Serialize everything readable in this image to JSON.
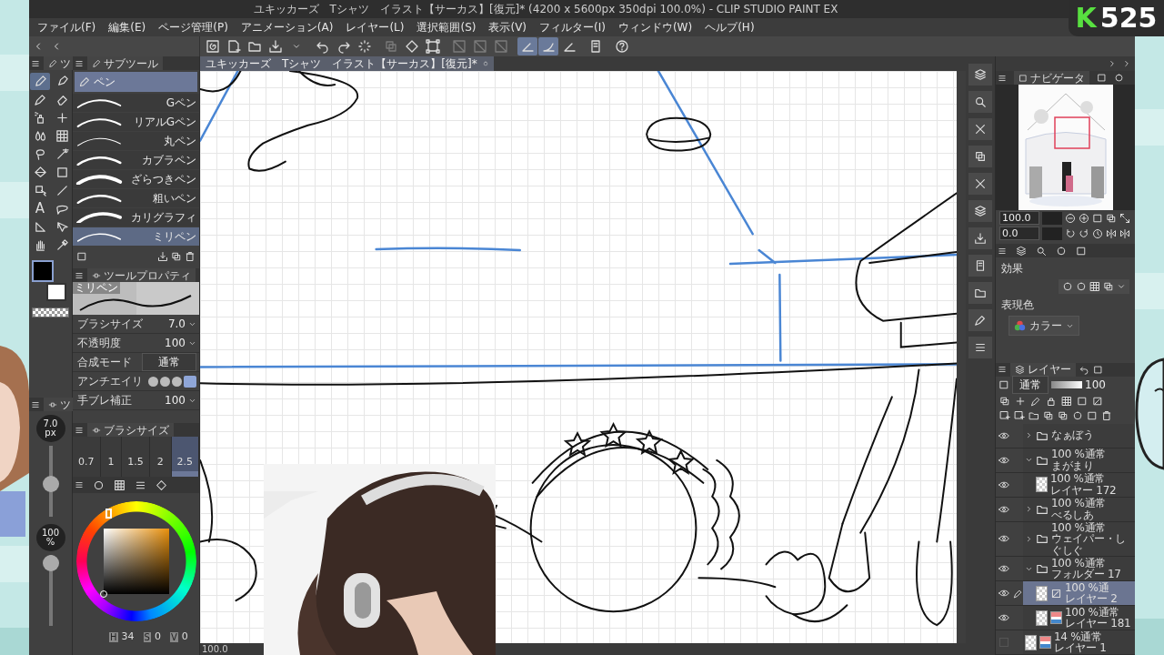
{
  "window": {
    "title": "ユキッカーズ　Tシャツ　イラスト【サーカス】[復元]* (4200 x 5600px 350dpi 100.0%)  - CLIP STUDIO PAINT EX"
  },
  "overlay_logo": {
    "letter": "K",
    "number": "525"
  },
  "menu": [
    "ファイル(F)",
    "編集(E)",
    "ページ管理(P)",
    "アニメーション(A)",
    "レイヤー(L)",
    "選択範囲(S)",
    "表示(V)",
    "フィルター(I)",
    "ウィンドウ(W)",
    "ヘルプ(H)"
  ],
  "toolbar": [
    {
      "on": false,
      "disabled": false
    },
    {
      "on": false,
      "disabled": false
    },
    {
      "on": false,
      "disabled": false
    },
    {
      "on": false,
      "disabled": false
    },
    {
      "on": false,
      "disabled": false
    },
    {
      "on": false,
      "disabled": false
    },
    {
      "on": false,
      "disabled": false
    },
    {
      "on": false,
      "disabled": false
    },
    {
      "on": false,
      "disabled": true
    },
    {
      "on": false,
      "disabled": false
    },
    {
      "on": false,
      "disabled": false
    },
    {
      "on": false,
      "disabled": true
    },
    {
      "on": false,
      "disabled": true
    },
    {
      "on": false,
      "disabled": true
    },
    {
      "on": true,
      "disabled": false
    },
    {
      "on": true,
      "disabled": false
    },
    {
      "on": false,
      "disabled": false
    },
    {
      "on": false,
      "disabled": false
    },
    {
      "on": false,
      "disabled": false
    }
  ],
  "document_tab": {
    "title": "ユキッカーズ　Tシャツ　イラスト【サーカス】[復元]*"
  },
  "tool_palette": {
    "tab": "ツ",
    "tools": [
      {
        "selected": true
      },
      {
        "selected": false
      },
      {
        "selected": false
      },
      {
        "selected": false
      },
      {
        "selected": false
      },
      {
        "selected": false
      },
      {
        "selected": false
      },
      {
        "selected": false
      },
      {
        "selected": false
      },
      {
        "selected": false
      },
      {
        "selected": false
      },
      {
        "selected": false
      },
      {
        "selected": false
      },
      {
        "selected": false
      },
      {
        "selected": false,
        "glyph": "A"
      },
      {
        "selected": false
      },
      {
        "selected": false
      },
      {
        "selected": false
      },
      {
        "selected": false
      },
      {
        "selected": false
      }
    ]
  },
  "colors": [
    {
      "color": "#000000",
      "selected": true
    },
    {
      "color": "#ffffff",
      "selected": false
    }
  ],
  "subtool": {
    "title": "サブツール",
    "group": "ペン",
    "items": [
      {
        "label": "Gペン",
        "selected": false
      },
      {
        "label": "リアルGペン",
        "selected": false
      },
      {
        "label": "丸ペン",
        "selected": false
      },
      {
        "label": "カブラペン",
        "selected": false
      },
      {
        "label": "ざらつきペン",
        "selected": false
      },
      {
        "label": "粗いペン",
        "selected": false
      },
      {
        "label": "カリグラフィ",
        "selected": false
      },
      {
        "label": "ミリペン",
        "selected": true
      }
    ]
  },
  "tool_property": {
    "title": "ツールプロパティ",
    "preview_label": "ミリペン",
    "rows": [
      {
        "kind": "number",
        "label": "ブラシサイズ",
        "value": "7.0"
      },
      {
        "kind": "number",
        "label": "不透明度",
        "value": "100"
      },
      {
        "kind": "select",
        "label": "合成モード",
        "value": "通常"
      },
      {
        "kind": "options",
        "label": "アンチエイリ",
        "options": [
          {
            "selected": false
          },
          {
            "selected": false
          },
          {
            "selected": false
          },
          {
            "selected": true
          }
        ]
      },
      {
        "kind": "number",
        "label": "手ブレ補正",
        "value": "100"
      }
    ]
  },
  "quick_sliders": {
    "tab": "ツ",
    "size": {
      "reading": "7.0",
      "unit": "px",
      "level": 0.45
    },
    "opacity": {
      "reading": "100",
      "unit": "%",
      "level": 1
    }
  },
  "brush_size": {
    "title": "ブラシサイズ",
    "presets": [
      {
        "label": "0.7",
        "selected": false
      },
      {
        "label": "1",
        "selected": false
      },
      {
        "label": "1.5",
        "selected": false
      },
      {
        "label": "2",
        "selected": false
      },
      {
        "label": "2.5",
        "selected": true
      }
    ]
  },
  "color_wheel": {
    "h_label": "H",
    "h": "34",
    "s_label": "S",
    "s": "0",
    "v_label": "V",
    "v": "0"
  },
  "navigator": {
    "title": "ナビゲータ",
    "zoom": "100.0",
    "angle": "0.0"
  },
  "layer_property": {
    "effect_label": "効果",
    "color_label": "表現色",
    "color_mode": "カラー"
  },
  "layers": {
    "title": "レイヤー",
    "blend": "通常",
    "opacity": "100",
    "opacity_slider": {
      "level": 1
    },
    "items": [
      {
        "kind": "folder",
        "name": "なぁぼう",
        "visible": true,
        "expanded": false,
        "selected": false
      },
      {
        "kind": "folder",
        "blend": "100 %通常",
        "name": "まがまり",
        "visible": true,
        "expanded": true,
        "selected": false,
        "children": [
          {
            "kind": "layer",
            "blend": "100 %通常",
            "name": "レイヤー 172",
            "visible": true,
            "selected": false
          }
        ]
      },
      {
        "kind": "folder",
        "blend": "100 %通常",
        "name": "べるしあ",
        "visible": true,
        "expanded": false,
        "selected": false
      },
      {
        "kind": "folder",
        "blend": "100 %通常",
        "name": "ウェイパー・しぐしぐ",
        "visible": true,
        "expanded": false,
        "selected": false
      },
      {
        "kind": "folder",
        "blend": "100 %通常",
        "name": "フォルダー 17",
        "visible": true,
        "expanded": true,
        "selected": false,
        "children": [
          {
            "kind": "vector",
            "blend": "100 %通",
            "name": "レイヤー 2",
            "visible": true,
            "selected": true
          },
          {
            "kind": "raster",
            "blend": "100 %通常",
            "name": "レイヤー 181",
            "visible": true,
            "selected": false
          }
        ]
      },
      {
        "kind": "raster",
        "blend": "14 %通常",
        "name": "レイヤー 1",
        "visible": false,
        "selected": false
      }
    ]
  },
  "status": {
    "zoom": "100.0"
  }
}
